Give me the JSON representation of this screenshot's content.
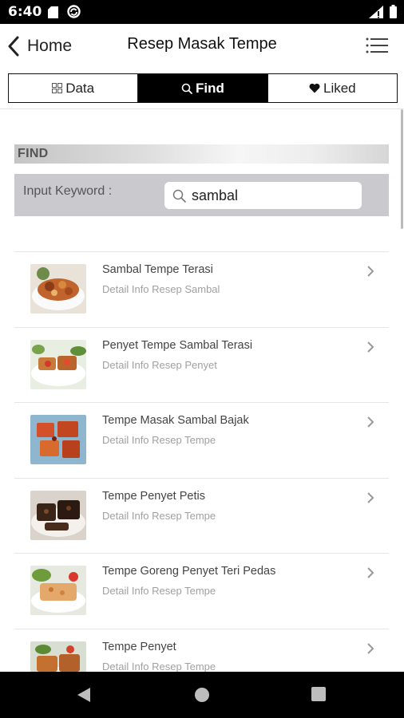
{
  "status_bar": {
    "time": "6:40"
  },
  "app_bar": {
    "back_label": "Home",
    "title": "Resep Masak Tempe"
  },
  "tabs": [
    {
      "label": "Data",
      "icon": "grid-icon",
      "active": false
    },
    {
      "label": "Find",
      "icon": "search-icon",
      "active": true
    },
    {
      "label": "Liked",
      "icon": "heart-icon",
      "active": false
    }
  ],
  "find": {
    "header": "FIND",
    "label": "Input Keyword :",
    "value": "sambal"
  },
  "results": [
    {
      "name": "Sambal Tempe Terasi",
      "desc": "Detail Info Resep Sambal"
    },
    {
      "name": "Penyet Tempe Sambal Terasi",
      "desc": "Detail Info Resep Penyet"
    },
    {
      "name": "Tempe Masak Sambal Bajak",
      "desc": "Detail Info Resep Tempe"
    },
    {
      "name": "Tempe Penyet Petis",
      "desc": "Detail Info Resep Tempe"
    },
    {
      "name": "Tempe Goreng Penyet Teri Pedas",
      "desc": "Detail Info Resep Tempe"
    },
    {
      "name": "Tempe Penyet",
      "desc": "Detail Info Resep Tempe"
    }
  ],
  "colors": {
    "accent": "#000000",
    "panel": "#c9c9ce"
  }
}
